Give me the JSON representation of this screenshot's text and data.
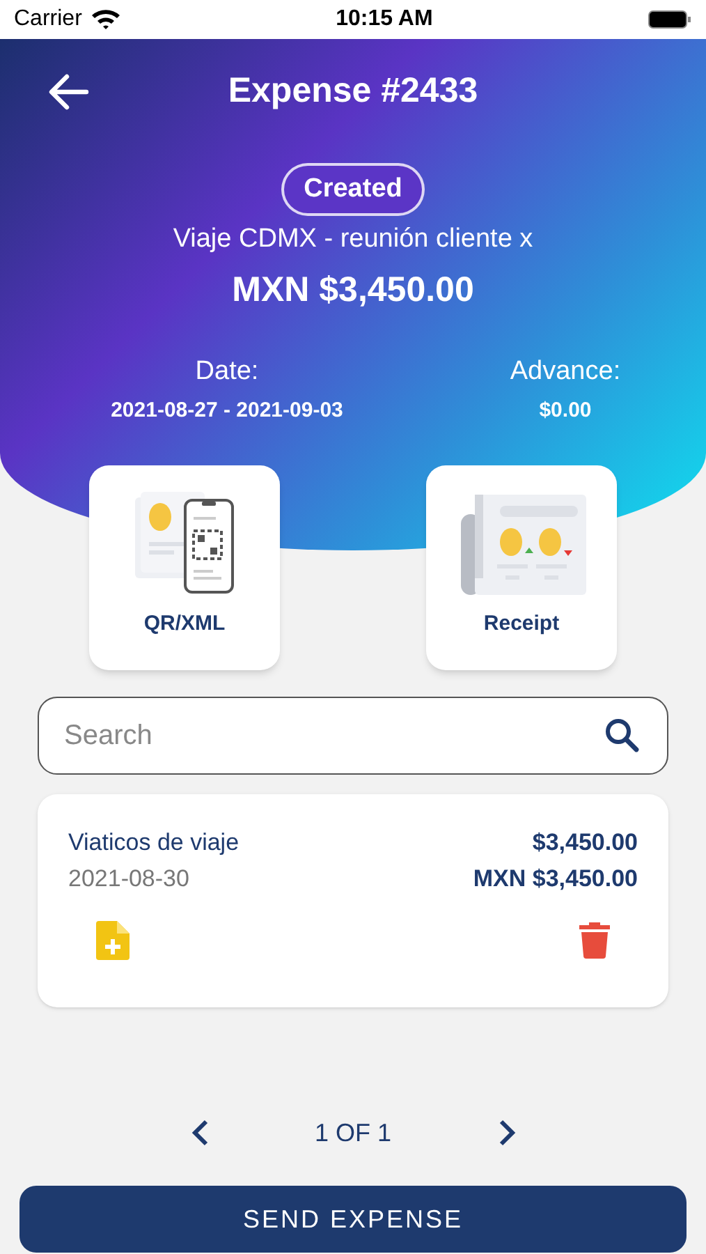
{
  "status_bar": {
    "carrier": "Carrier",
    "time": "10:15 AM"
  },
  "header": {
    "title": "Expense #2433",
    "status": "Created",
    "description": "Viaje CDMX - reunión cliente x",
    "amount": "MXN $3,450.00",
    "date_label": "Date:",
    "date_value": "2021-08-27 - 2021-09-03",
    "advance_label": "Advance:",
    "advance_value": "$0.00"
  },
  "options": [
    {
      "kind": "qr",
      "label": "QR/XML"
    },
    {
      "kind": "receipt",
      "label": "Receipt"
    }
  ],
  "search": {
    "placeholder": "Search"
  },
  "expenses": [
    {
      "name": "Viaticos de viaje",
      "date": "2021-08-30",
      "amount": "$3,450.00",
      "amount_mxn": "MXN $3,450.00"
    }
  ],
  "pagination": {
    "text": "1 OF 1"
  },
  "primary_button": "SEND EXPENSE"
}
